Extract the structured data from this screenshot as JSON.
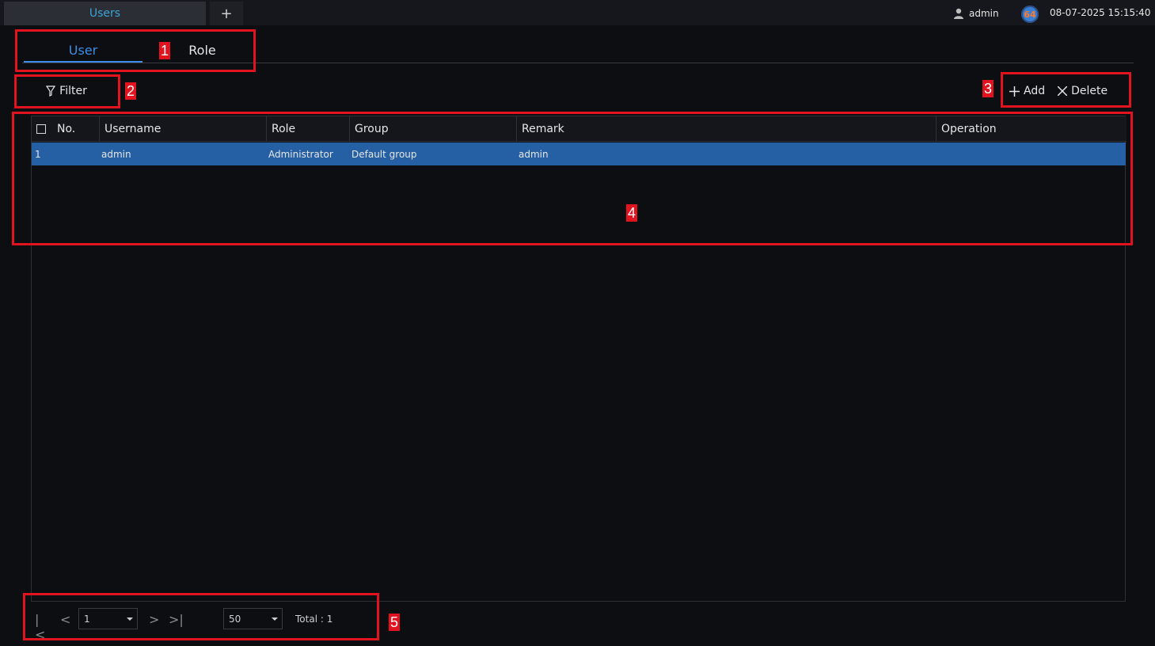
{
  "topbar": {
    "tab_title": "Users",
    "new_tab_symbol": "+",
    "username": "admin",
    "notification_count": "64",
    "datetime": "08-07-2025 15:15:40"
  },
  "tabs": [
    {
      "label": "User",
      "active": true
    },
    {
      "label": "Role",
      "active": false
    }
  ],
  "toolbar": {
    "filter_label": "Filter",
    "add_label": "Add",
    "delete_label": "Delete"
  },
  "table": {
    "columns": [
      "No.",
      "Username",
      "Role",
      "Group",
      "Remark",
      "Operation"
    ],
    "rows": [
      {
        "no": "1",
        "username": "admin",
        "role": "Administrator",
        "group": "Default group",
        "remark": "admin",
        "operation": ""
      }
    ]
  },
  "pagination": {
    "current_page": "1",
    "page_size": "50",
    "total_label": "Total : 1"
  },
  "annotations": [
    "1",
    "2",
    "3",
    "4",
    "5"
  ],
  "colors": {
    "accent": "#3d8ee8",
    "selected_row": "#2660a4",
    "annotation": "#e0131f",
    "background": "#0d0e12"
  }
}
